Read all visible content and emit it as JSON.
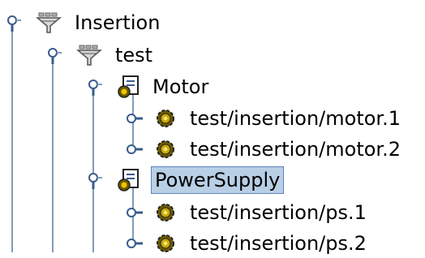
{
  "tree": {
    "nodes": [
      {
        "label": "Insertion",
        "icon": "filter-funnel-icon",
        "expanded": true,
        "level": 0
      },
      {
        "label": "test",
        "icon": "filter-funnel-icon",
        "expanded": true,
        "level": 1
      },
      {
        "label": "Motor",
        "icon": "device-class-icon",
        "expanded": true,
        "level": 2
      },
      {
        "label": "test/insertion/motor.1",
        "icon": "gear-device-icon",
        "expanded": false,
        "level": 3
      },
      {
        "label": "test/insertion/motor.2",
        "icon": "gear-device-icon",
        "expanded": false,
        "level": 3
      },
      {
        "label": "PowerSupply",
        "icon": "device-class-icon",
        "expanded": true,
        "level": 2,
        "selected": true
      },
      {
        "label": "test/insertion/ps.1",
        "icon": "gear-device-icon",
        "expanded": false,
        "level": 3
      },
      {
        "label": "test/insertion/ps.2",
        "icon": "gear-device-icon",
        "expanded": false,
        "level": 3
      }
    ]
  },
  "colors": {
    "line": "#7f9db9",
    "handle": "#3a5c8c",
    "selection": "#b8cfe5",
    "selection_border": "#6382bf"
  }
}
